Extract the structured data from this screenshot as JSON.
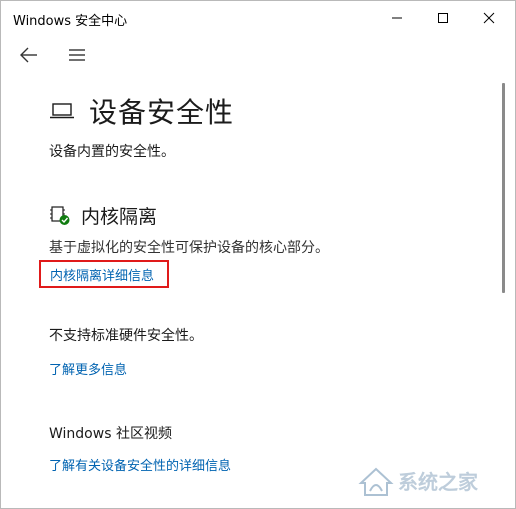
{
  "window": {
    "title": "Windows 安全中心"
  },
  "page": {
    "title": "设备安全性",
    "subtitle": "设备内置的安全性。"
  },
  "core_isolation": {
    "title": "内核隔离",
    "description": "基于虚拟化的安全性可保护设备的核心部分。",
    "details_link": "内核隔离详细信息"
  },
  "hardware": {
    "status_text": "不支持标准硬件安全性。",
    "learn_more_link": "了解更多信息"
  },
  "community": {
    "title": "Windows 社区视频",
    "video_link": "了解有关设备安全性的详细信息"
  },
  "watermark": {
    "text": "系统之家",
    "icons": [
      "house-logo-icon"
    ]
  },
  "colors": {
    "link": "#0063b1",
    "highlight_box": "#e01a1a",
    "status_ok": "#107c10"
  }
}
